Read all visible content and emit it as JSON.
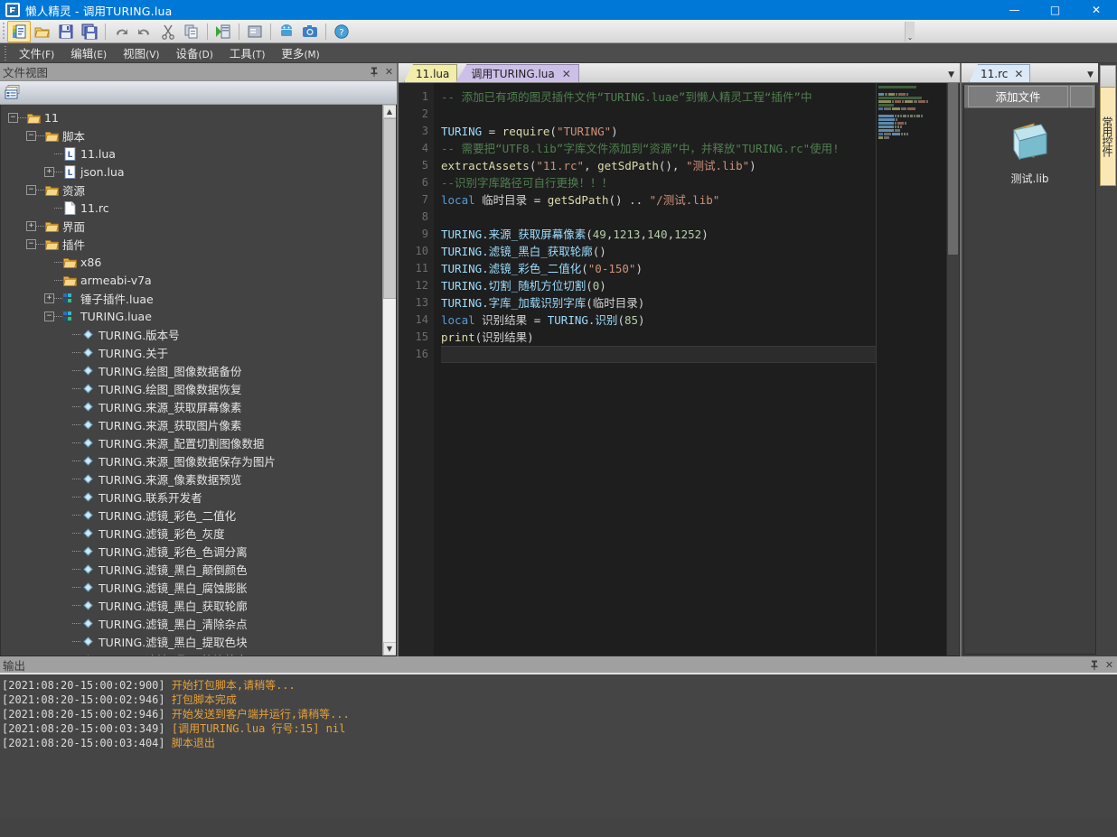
{
  "window": {
    "title": "懒人精灵 - 调用TURING.lua",
    "app_icon": "app-icon",
    "minimize": "—",
    "maximize": "□",
    "close": "✕"
  },
  "toolbar": {
    "buttons": [
      {
        "name": "new-project-icon",
        "glyph": "new"
      },
      {
        "name": "open-folder-icon",
        "glyph": "open"
      },
      {
        "name": "save-icon",
        "glyph": "save"
      },
      {
        "name": "save-all-icon",
        "glyph": "saveall"
      },
      {
        "name": "redo-icon",
        "glyph": "redo"
      },
      {
        "name": "undo-icon",
        "glyph": "undo"
      },
      {
        "name": "cut-icon",
        "glyph": "cut"
      },
      {
        "name": "copy-icon",
        "glyph": "copy"
      },
      {
        "name": "run-icon",
        "glyph": "run"
      },
      {
        "name": "stop-icon",
        "glyph": "stop"
      },
      {
        "name": "android-device-icon",
        "glyph": "android"
      },
      {
        "name": "screenshot-icon",
        "glyph": "camera"
      },
      {
        "name": "help-icon",
        "glyph": "help"
      }
    ],
    "overflow": "⌄"
  },
  "menubar": {
    "items": [
      {
        "label": "文件",
        "mnemonic": "(F)"
      },
      {
        "label": "编辑",
        "mnemonic": "(E)"
      },
      {
        "label": "视图",
        "mnemonic": "(V)"
      },
      {
        "label": "设备",
        "mnemonic": "(D)"
      },
      {
        "label": "工具",
        "mnemonic": "(T)"
      },
      {
        "label": "更多",
        "mnemonic": "(M)"
      }
    ]
  },
  "fileview": {
    "title": "文件视图",
    "pin": "📌",
    "close": "✕",
    "toolbar_icon": "project-list-icon",
    "tree": [
      {
        "depth": 0,
        "toggle": "-",
        "icon": "folder",
        "label": "11"
      },
      {
        "depth": 1,
        "toggle": "-",
        "icon": "folder",
        "label": "脚本"
      },
      {
        "depth": 2,
        "toggle": "",
        "icon": "lua",
        "label": "11.lua"
      },
      {
        "depth": 2,
        "toggle": "+",
        "icon": "lua",
        "label": "json.lua"
      },
      {
        "depth": 1,
        "toggle": "-",
        "icon": "folder",
        "label": "资源"
      },
      {
        "depth": 2,
        "toggle": "",
        "icon": "file",
        "label": "11.rc"
      },
      {
        "depth": 1,
        "toggle": "+",
        "icon": "folder",
        "label": "界面"
      },
      {
        "depth": 1,
        "toggle": "-",
        "icon": "folder",
        "label": "插件"
      },
      {
        "depth": 2,
        "toggle": "",
        "icon": "folder",
        "label": "x86"
      },
      {
        "depth": 2,
        "toggle": "",
        "icon": "folder",
        "label": "armeabi-v7a"
      },
      {
        "depth": 2,
        "toggle": "+",
        "icon": "plugin",
        "label": "锤子插件.luae"
      },
      {
        "depth": 2,
        "toggle": "-",
        "icon": "plugin",
        "label": "TURING.luae"
      },
      {
        "depth": 3,
        "toggle": "",
        "icon": "method",
        "label": "TURING.版本号"
      },
      {
        "depth": 3,
        "toggle": "",
        "icon": "method",
        "label": "TURING.关于"
      },
      {
        "depth": 3,
        "toggle": "",
        "icon": "method",
        "label": "TURING.绘图_图像数据备份"
      },
      {
        "depth": 3,
        "toggle": "",
        "icon": "method",
        "label": "TURING.绘图_图像数据恢复"
      },
      {
        "depth": 3,
        "toggle": "",
        "icon": "method",
        "label": "TURING.来源_获取屏幕像素"
      },
      {
        "depth": 3,
        "toggle": "",
        "icon": "method",
        "label": "TURING.来源_获取图片像素"
      },
      {
        "depth": 3,
        "toggle": "",
        "icon": "method",
        "label": "TURING.来源_配置切割图像数据"
      },
      {
        "depth": 3,
        "toggle": "",
        "icon": "method",
        "label": "TURING.来源_图像数据保存为图片"
      },
      {
        "depth": 3,
        "toggle": "",
        "icon": "method",
        "label": "TURING.来源_像素数据预览"
      },
      {
        "depth": 3,
        "toggle": "",
        "icon": "method",
        "label": "TURING.联系开发者"
      },
      {
        "depth": 3,
        "toggle": "",
        "icon": "method",
        "label": "TURING.滤镜_彩色_二值化"
      },
      {
        "depth": 3,
        "toggle": "",
        "icon": "method",
        "label": "TURING.滤镜_彩色_灰度"
      },
      {
        "depth": 3,
        "toggle": "",
        "icon": "method",
        "label": "TURING.滤镜_彩色_色调分离"
      },
      {
        "depth": 3,
        "toggle": "",
        "icon": "method",
        "label": "TURING.滤镜_黑白_颠倒颜色"
      },
      {
        "depth": 3,
        "toggle": "",
        "icon": "method",
        "label": "TURING.滤镜_黑白_腐蚀膨胀"
      },
      {
        "depth": 3,
        "toggle": "",
        "icon": "method",
        "label": "TURING.滤镜_黑白_获取轮廓"
      },
      {
        "depth": 3,
        "toggle": "",
        "icon": "method",
        "label": "TURING.滤镜_黑白_清除杂点"
      },
      {
        "depth": 3,
        "toggle": "",
        "icon": "method",
        "label": "TURING.滤镜_黑白_提取色块"
      },
      {
        "depth": 3,
        "toggle": "",
        "icon": "method",
        "label": "TURING.滤镜_通用_等比放大"
      }
    ]
  },
  "editor": {
    "tabs": [
      {
        "label": "11.lua",
        "active": false,
        "closable": false
      },
      {
        "label": "调用TURING.lua",
        "active": true,
        "closable": true,
        "close": "✕"
      }
    ],
    "tab_menu": "▼",
    "first_line": 1,
    "last_line": 16,
    "lines": [
      {
        "no": 1,
        "tokens": [
          {
            "t": "c",
            "v": "-- 添加已有项的图灵插件文件“TURING.luae”到懒人精灵工程“插件”中"
          }
        ]
      },
      {
        "no": 2,
        "tokens": []
      },
      {
        "no": 3,
        "tokens": [
          {
            "t": "id",
            "v": "TURING"
          },
          {
            "t": "p",
            "v": " = "
          },
          {
            "t": "f",
            "v": "require"
          },
          {
            "t": "p",
            "v": "("
          },
          {
            "t": "s",
            "v": "\"TURING\""
          },
          {
            "t": "p",
            "v": ")"
          }
        ]
      },
      {
        "no": 4,
        "tokens": [
          {
            "t": "c",
            "v": "-- 需要把“UTF8.lib”字库文件添加到“资源”中，并释放\"TURING.rc\"使用!"
          }
        ]
      },
      {
        "no": 5,
        "tokens": [
          {
            "t": "f",
            "v": "extractAssets"
          },
          {
            "t": "p",
            "v": "("
          },
          {
            "t": "s",
            "v": "\"11.rc\""
          },
          {
            "t": "p",
            "v": ", "
          },
          {
            "t": "f",
            "v": "getSdPath"
          },
          {
            "t": "p",
            "v": "(), "
          },
          {
            "t": "s",
            "v": "\"测试.lib\""
          },
          {
            "t": "p",
            "v": ")"
          }
        ]
      },
      {
        "no": 6,
        "tokens": [
          {
            "t": "c",
            "v": "--识别字库路径可自行更换！！！"
          }
        ]
      },
      {
        "no": 7,
        "tokens": [
          {
            "t": "k",
            "v": "local"
          },
          {
            "t": "p",
            "v": " 临时目录 = "
          },
          {
            "t": "f",
            "v": "getSdPath"
          },
          {
            "t": "p",
            "v": "() .. "
          },
          {
            "t": "s",
            "v": "\"/测试.lib\""
          }
        ]
      },
      {
        "no": 8,
        "tokens": []
      },
      {
        "no": 9,
        "tokens": [
          {
            "t": "id",
            "v": "TURING.来源_获取屏幕像素"
          },
          {
            "t": "p",
            "v": "("
          },
          {
            "t": "n",
            "v": "49"
          },
          {
            "t": "p",
            "v": ","
          },
          {
            "t": "n",
            "v": "1213"
          },
          {
            "t": "p",
            "v": ","
          },
          {
            "t": "n",
            "v": "140"
          },
          {
            "t": "p",
            "v": ","
          },
          {
            "t": "n",
            "v": "1252"
          },
          {
            "t": "p",
            "v": ")"
          }
        ]
      },
      {
        "no": 10,
        "tokens": [
          {
            "t": "id",
            "v": "TURING.滤镜_黑白_获取轮廓"
          },
          {
            "t": "p",
            "v": "()"
          }
        ]
      },
      {
        "no": 11,
        "tokens": [
          {
            "t": "id",
            "v": "TURING.滤镜_彩色_二值化"
          },
          {
            "t": "p",
            "v": "("
          },
          {
            "t": "s",
            "v": "\"0-150\""
          },
          {
            "t": "p",
            "v": ")"
          }
        ]
      },
      {
        "no": 12,
        "tokens": [
          {
            "t": "id",
            "v": "TURING.切割_随机方位切割"
          },
          {
            "t": "p",
            "v": "("
          },
          {
            "t": "n",
            "v": "0"
          },
          {
            "t": "p",
            "v": ")"
          }
        ]
      },
      {
        "no": 13,
        "tokens": [
          {
            "t": "id",
            "v": "TURING.字库_加载识别字库"
          },
          {
            "t": "p",
            "v": "(临时目录)"
          }
        ]
      },
      {
        "no": 14,
        "tokens": [
          {
            "t": "k",
            "v": "local"
          },
          {
            "t": "p",
            "v": " 识别结果 = "
          },
          {
            "t": "id",
            "v": "TURING.识别"
          },
          {
            "t": "p",
            "v": "("
          },
          {
            "t": "n",
            "v": "85"
          },
          {
            "t": "p",
            "v": ")"
          }
        ]
      },
      {
        "no": 15,
        "tokens": [
          {
            "t": "f",
            "v": "print"
          },
          {
            "t": "p",
            "v": "(识别结果)"
          }
        ]
      },
      {
        "no": 16,
        "tokens": []
      }
    ]
  },
  "rightpanel": {
    "tab": {
      "label": "11.rc",
      "close": "✕"
    },
    "tab_menu": "▼",
    "add_file_button": "添加文件",
    "files": [
      {
        "name": "测试.lib",
        "icon": "lib-file-icon"
      }
    ],
    "vertical_tab": "常用控件"
  },
  "output": {
    "title": "输出",
    "pin": "📌",
    "close": "✕",
    "lines": [
      {
        "ts": "[2021:08:20-15:00:02:900]",
        "msg": "开始打包脚本,请稍等..."
      },
      {
        "ts": "[2021:08:20-15:00:02:946]",
        "msg": "打包脚本完成"
      },
      {
        "ts": "[2021:08:20-15:00:02:946]",
        "msg": "开始发送到客户端并运行,请稍等..."
      },
      {
        "ts": "[2021:08:20-15:00:03:349]",
        "msg": "[调用TURING.lua 行号:15] nil"
      },
      {
        "ts": "[2021:08:20-15:00:03:404]",
        "msg": "脚本退出"
      }
    ]
  },
  "colors": {
    "titlebar": "#0078d7",
    "panel_header": "#a0a0a0",
    "dark_bg": "#434343",
    "editor_bg": "#1e1e1e",
    "output_text": "#e7a13a",
    "tab_active": "#cdc0e8",
    "tab_inactive": "#f3edaa"
  }
}
